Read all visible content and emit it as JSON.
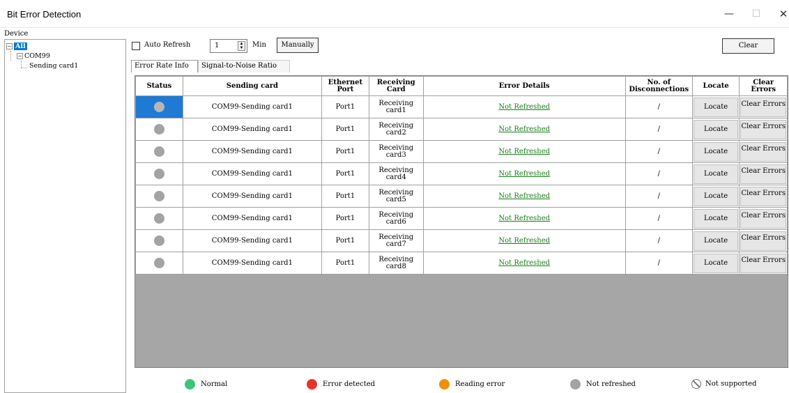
{
  "window": {
    "title": "Bit Error Detection",
    "min_glyph": "—",
    "max_glyph": "☐",
    "close_glyph": "✕"
  },
  "device_panel": {
    "label": "Device",
    "tree": {
      "root_label": "All",
      "child_label": "COM99",
      "leaf_label": "Sending card1"
    }
  },
  "toolbar": {
    "auto_refresh_label": "Auto Refresh",
    "auto_refresh_checked": false,
    "interval_value": "1",
    "interval_unit": "Min",
    "manually_label": "Manually",
    "clear_label": "Clear"
  },
  "tabs": [
    {
      "label": "Error Rate Info",
      "active": true
    },
    {
      "label": "Signal-to-Noise Ratio",
      "active": false
    }
  ],
  "table": {
    "columns": [
      {
        "label": "Status"
      },
      {
        "label": "Sending card"
      },
      {
        "label": "Ethernet Port"
      },
      {
        "label": "Receiving Card"
      },
      {
        "label": "Error Details"
      },
      {
        "label": "No. of Disconnections"
      },
      {
        "label": "Locate"
      },
      {
        "label": "Clear Errors"
      }
    ],
    "rows": [
      {
        "status": "not-refreshed",
        "sending_card": "COM99-Sending card1",
        "port": "Port1",
        "receiving_card": "Receiving card1",
        "error_details": "Not Refreshed",
        "disconnections": "/",
        "locate": "Locate",
        "clear": "Clear Errors",
        "selected": true
      },
      {
        "status": "not-refreshed",
        "sending_card": "COM99-Sending card1",
        "port": "Port1",
        "receiving_card": "Receiving card2",
        "error_details": "Not Refreshed",
        "disconnections": "/",
        "locate": "Locate",
        "clear": "Clear Errors",
        "selected": false
      },
      {
        "status": "not-refreshed",
        "sending_card": "COM99-Sending card1",
        "port": "Port1",
        "receiving_card": "Receiving card3",
        "error_details": "Not Refreshed",
        "disconnections": "/",
        "locate": "Locate",
        "clear": "Clear Errors",
        "selected": false
      },
      {
        "status": "not-refreshed",
        "sending_card": "COM99-Sending card1",
        "port": "Port1",
        "receiving_card": "Receiving card4",
        "error_details": "Not Refreshed",
        "disconnections": "/",
        "locate": "Locate",
        "clear": "Clear Errors",
        "selected": false
      },
      {
        "status": "not-refreshed",
        "sending_card": "COM99-Sending card1",
        "port": "Port1",
        "receiving_card": "Receiving card5",
        "error_details": "Not Refreshed",
        "disconnections": "/",
        "locate": "Locate",
        "clear": "Clear Errors",
        "selected": false
      },
      {
        "status": "not-refreshed",
        "sending_card": "COM99-Sending card1",
        "port": "Port1",
        "receiving_card": "Receiving card6",
        "error_details": "Not Refreshed",
        "disconnections": "/",
        "locate": "Locate",
        "clear": "Clear Errors",
        "selected": false
      },
      {
        "status": "not-refreshed",
        "sending_card": "COM99-Sending card1",
        "port": "Port1",
        "receiving_card": "Receiving card7",
        "error_details": "Not Refreshed",
        "disconnections": "/",
        "locate": "Locate",
        "clear": "Clear Errors",
        "selected": false
      },
      {
        "status": "not-refreshed",
        "sending_card": "COM99-Sending card1",
        "port": "Port1",
        "receiving_card": "Receiving card8",
        "error_details": "Not Refreshed",
        "disconnections": "/",
        "locate": "Locate",
        "clear": "Clear Errors",
        "selected": false
      }
    ]
  },
  "legend": [
    {
      "key": "normal",
      "label": "Normal",
      "color": "#3cc47c"
    },
    {
      "key": "error-detected",
      "label": "Error detected",
      "color": "#e8342b"
    },
    {
      "key": "reading-error",
      "label": "Reading error",
      "color": "#f0900a"
    },
    {
      "key": "not-refreshed",
      "label": "Not refreshed",
      "color": "#a3a3a3"
    },
    {
      "key": "not-supported",
      "label": "Not supported",
      "icon": "not-supported-icon"
    }
  ],
  "colors": {
    "selection": "#1e7ad4",
    "grid_background": "#a6a6a6",
    "link": "#1a7d1a"
  }
}
